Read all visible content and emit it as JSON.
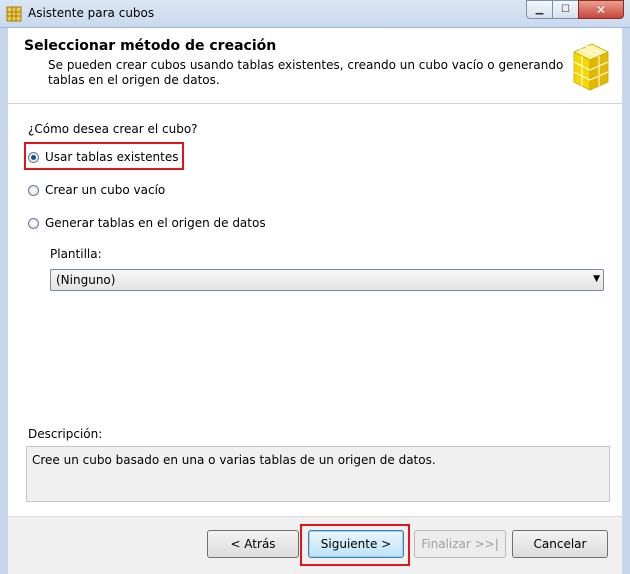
{
  "window": {
    "title": "Asistente para cubos",
    "minimize_symbol": "▁",
    "maximize_symbol": "☐",
    "close_symbol": "✕"
  },
  "header": {
    "title": "Seleccionar método de creación",
    "description": "Se pueden crear cubos usando tablas existentes, creando un cubo vacío o generando tablas en el origen de datos.",
    "icon": "cube-icon"
  },
  "main": {
    "question": "¿Cómo desea crear el cubo?",
    "options": [
      {
        "label": "Usar tablas existentes",
        "checked": true
      },
      {
        "label": "Crear un cubo vacío",
        "checked": false
      },
      {
        "label": "Generar tablas en el origen de datos",
        "checked": false
      }
    ],
    "template_label": "Plantilla:",
    "template_value": "(Ninguno)"
  },
  "description": {
    "label": "Descripción:",
    "text": "Cree un cubo basado en una o varias tablas de un origen de datos."
  },
  "footer": {
    "back_label": "< Atrás",
    "next_label": "Siguiente >",
    "finish_label": "Finalizar >>|",
    "cancel_label": "Cancelar"
  },
  "colors": {
    "highlight": "#e0141c",
    "titlebar": "#c9d9ee"
  }
}
